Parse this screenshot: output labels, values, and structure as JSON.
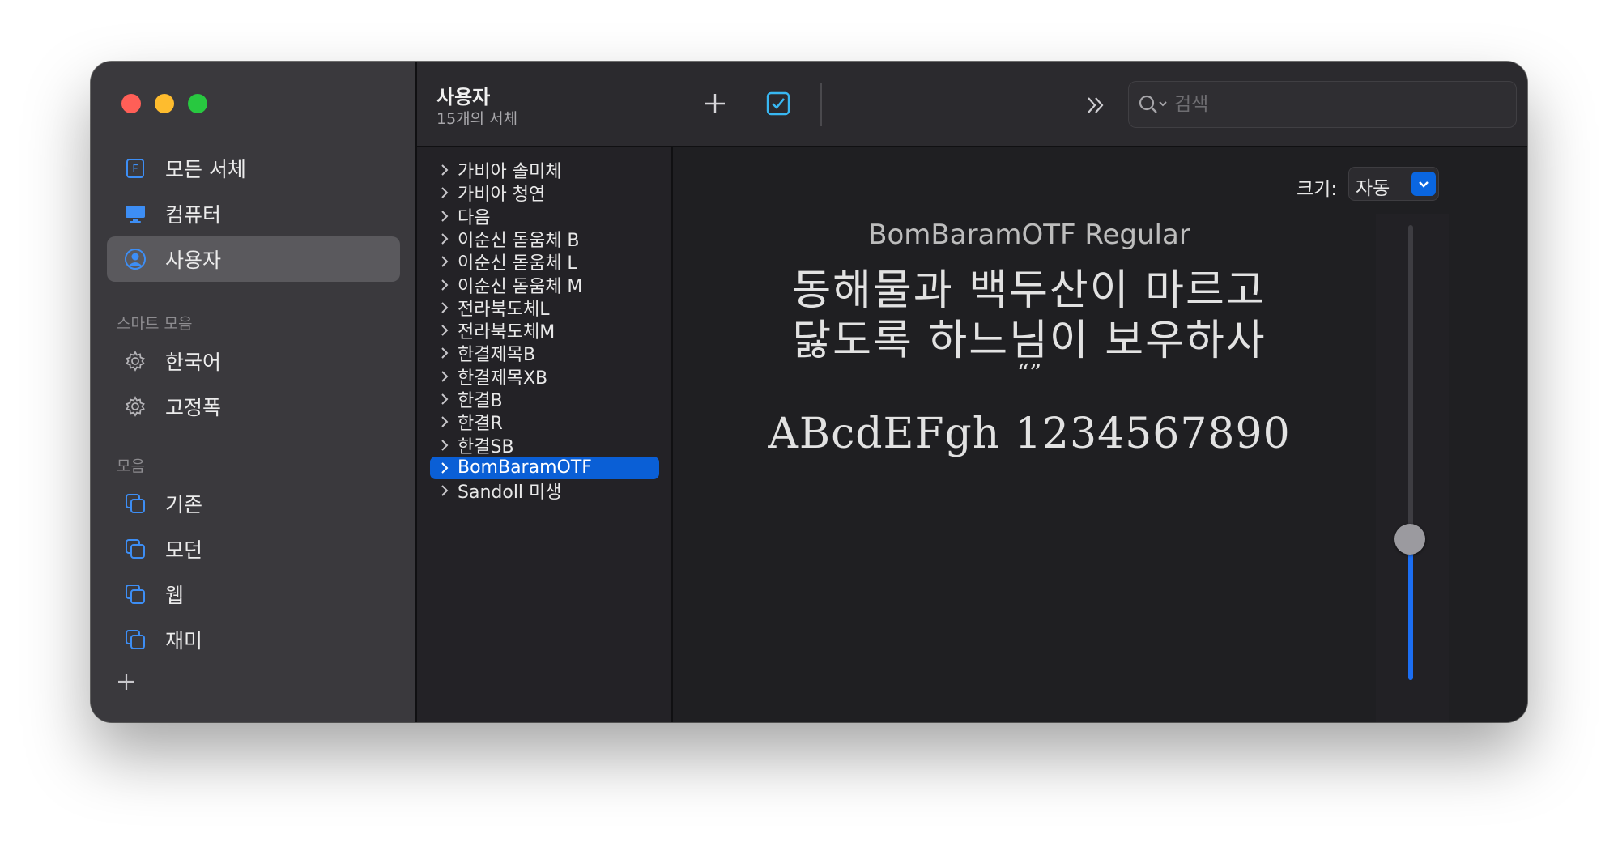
{
  "sidebar": {
    "library_items": [
      {
        "label": "모든 서체",
        "icon": "font-book-icon"
      },
      {
        "label": "컴퓨터",
        "icon": "computer-icon"
      },
      {
        "label": "사용자",
        "icon": "user-icon",
        "selected": true
      }
    ],
    "smart_header": "스마트 모음",
    "smart_items": [
      {
        "label": "한국어",
        "icon": "gear-icon"
      },
      {
        "label": "고정폭",
        "icon": "gear-icon"
      }
    ],
    "collections_header": "모음",
    "collection_items": [
      {
        "label": "기존",
        "icon": "collection-icon"
      },
      {
        "label": "모던",
        "icon": "collection-icon"
      },
      {
        "label": "웹",
        "icon": "collection-icon"
      },
      {
        "label": "재미",
        "icon": "collection-icon"
      }
    ]
  },
  "toolbar": {
    "title": "사용자",
    "subtitle": "15개의 서체",
    "search_placeholder": "검색"
  },
  "fonts": [
    "가비아 솔미체",
    "가비아 청연",
    "다음",
    "이순신 돋움체 B",
    "이순신 돋움체 L",
    "이순신 돋움체 M",
    "전라북도체L",
    "전라북도체M",
    "한결제목B",
    "한결제목XB",
    "한결B",
    "한결R",
    "한결SB",
    "BomBaramOTF",
    "Sandoll 미생"
  ],
  "selected_font_index": 13,
  "preview": {
    "size_label": "크기:",
    "size_value": "자동",
    "font_name": "BomBaramOTF Regular",
    "line1": "동해물과 백두산이 마르고",
    "line2": "닳도록 하느님이 보우하사",
    "quote": "“”",
    "line3": "ABcdEFgh 1234567890",
    "size_slider_fraction": 0.31
  },
  "colors": {
    "accent": "#0a5fd6",
    "icon_blue": "#3d8ef5",
    "sidebar_bg": "#3a393d"
  }
}
